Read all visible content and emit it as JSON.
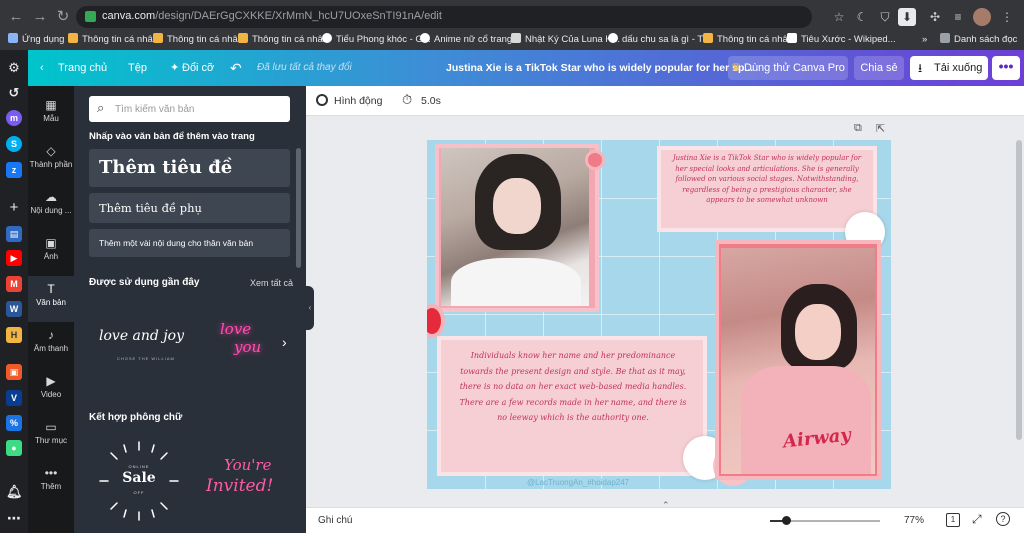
{
  "browser": {
    "url_host": "canva.com",
    "url_path": "/design/DAErGgCXKKE/XrMmN_hcU7UOxeSnTI91nA/edit",
    "bookmarks": [
      {
        "label": "Ứng dụng",
        "color": "#8ab4f8"
      },
      {
        "label": "Thông tin cá nhân",
        "color": "#f2b544"
      },
      {
        "label": "Thông tin cá nhân",
        "color": "#f2b544"
      },
      {
        "label": "Thông tin cá nhân",
        "color": "#f2b544"
      },
      {
        "label": "Tiểu Phong khóc - G...",
        "color": "#ffffff"
      },
      {
        "label": "Anime nữ cổ trang...",
        "color": "#ffffff"
      },
      {
        "label": "Nhật Ký Của Luna H...",
        "color": "#d9d9d9"
      },
      {
        "label": "dấu chu sa là gì - Ti...",
        "color": "#ffffff"
      },
      {
        "label": "Thông tin cá nhân",
        "color": "#f2b544"
      },
      {
        "label": "Tiêu Xước - Wikiped...",
        "color": "#ffffff"
      }
    ],
    "more_bookmarks": "»",
    "bookmark_list": "Danh sách đọc"
  },
  "header": {
    "home": "Trang chủ",
    "file": "Tệp",
    "resize": "Đổi cỡ",
    "saved": "Đã lưu tất cả thay đổi",
    "title": "Justina Xie is a TikTok Star who is widely popular for her sp...",
    "try_pro": "Dùng thử Canva Pro",
    "share": "Chia sẻ",
    "download": "Tải xuống",
    "more": "•••"
  },
  "rail": [
    {
      "name": "templates",
      "label": "Mẫu",
      "icon": "▦"
    },
    {
      "name": "elements",
      "label": "Thành phần",
      "icon": "◇"
    },
    {
      "name": "uploads",
      "label": "Nội dung ...",
      "icon": "☁"
    },
    {
      "name": "photos",
      "label": "Ảnh",
      "icon": "▣"
    },
    {
      "name": "text",
      "label": "Văn bản",
      "icon": "T"
    },
    {
      "name": "audio",
      "label": "Âm thanh",
      "icon": "♪"
    },
    {
      "name": "video",
      "label": "Video",
      "icon": "▶"
    },
    {
      "name": "folders",
      "label": "Thư mục",
      "icon": "▭"
    },
    {
      "name": "more",
      "label": "Thêm",
      "icon": "•••"
    }
  ],
  "panel": {
    "search_placeholder": "Tìm kiếm văn bản",
    "instruction": "Nhấp vào văn bản để thêm vào trang",
    "add_heading": "Thêm tiêu đề",
    "add_subheading": "Thêm tiêu đề phụ",
    "add_body": "Thêm một vài nội dung cho thân văn bản",
    "recent_title": "Được sử dụng gần đây",
    "see_all": "Xem tất cả",
    "recent_1_main": "love and joy",
    "recent_1_sub": "CHOSE THE WILLIAM",
    "recent_2_line1": "love",
    "recent_2_line2": "you",
    "combo_title": "Kết hợp phông chữ",
    "combo_1_top": "ONLINE",
    "combo_1_main": "Sale",
    "combo_1_sub": "OFF",
    "combo_2_line1": "You're",
    "combo_2_line2": "Invited!"
  },
  "editor": {
    "animate": "Hình động",
    "duration": "5.0s",
    "notes": "Ghi chú",
    "zoom": "77%",
    "page_count": "1"
  },
  "design": {
    "top_text": "Justina Xie is a TikTok Star who is widely popular for her special looks and articulations. She is generally followed on various social stages. Notwithstanding, regardless of being a prestigious character, she appears to be somewhat unknown",
    "bottom_text": "Individuals know her name and her predominance towards the present design and style. Be that as it may, there is no data on her exact web-based media handles. There are a few records made in her name, and there is no leeway which is the authority one.",
    "shirt_text": "Airway",
    "watermark": "@LacTruongAn_#hoidap247"
  }
}
